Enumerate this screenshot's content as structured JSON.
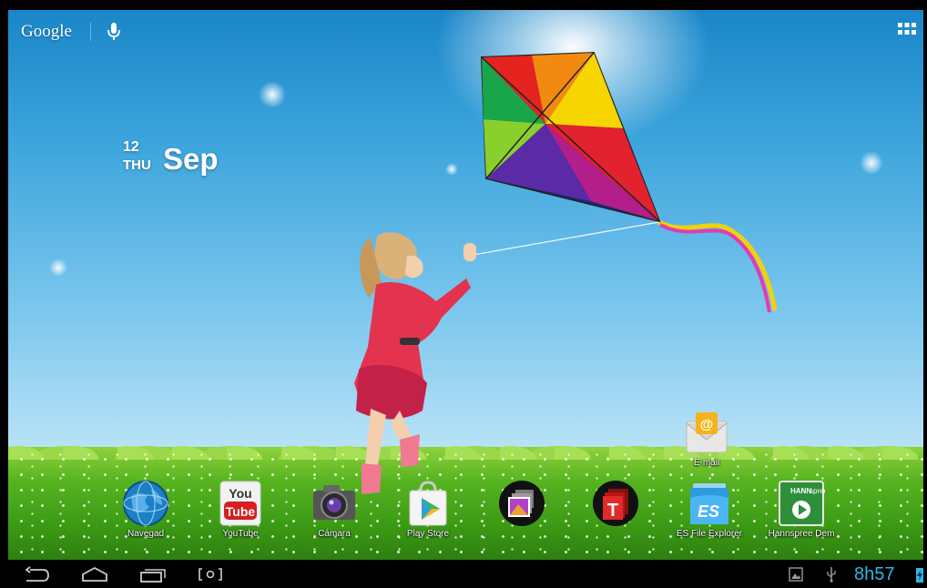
{
  "search": {
    "logo": "Google",
    "mic_icon": "microphone-icon"
  },
  "apps_button_icon": "all-apps-grid-icon",
  "clock": {
    "day": "12",
    "weekday": "THU",
    "month": "Sep"
  },
  "desktop_apps": [
    {
      "label": "E-mail",
      "icon": "email-icon"
    }
  ],
  "dock": [
    {
      "label": "Navegad",
      "icon": "globe-icon"
    },
    {
      "label": "YouTube",
      "icon": "youtube-icon"
    },
    {
      "label": "Cámara",
      "icon": "camera-icon"
    },
    {
      "label": "Play Store",
      "icon": "play-store-icon"
    },
    {
      "label": "",
      "icon": "gallery-icon"
    },
    {
      "label": "",
      "icon": "t-app-icon"
    },
    {
      "label": "ES File Explorer",
      "icon": "es-file-explorer-icon"
    },
    {
      "label": "Hannspree Dem",
      "icon": "hannspree-demo-icon"
    }
  ],
  "youtube_icon_text": {
    "top": "You",
    "bottom": "Tube"
  },
  "hannspree_icon_text": {
    "brand": "HANN",
    "brand2": "spree"
  },
  "es_icon_text": "ES",
  "navbar": {
    "back_icon": "back-icon",
    "home_icon": "home-icon",
    "recents_icon": "recent-apps-icon",
    "screenshot_icon": "screenshot-icon",
    "gallery_notif_icon": "image-notification-icon",
    "usb_icon": "usb-icon",
    "battery_icon": "battery-charging-icon",
    "time": "8h57"
  },
  "colors": {
    "accent_time": "#33b5e5",
    "sky": "#3ea6dd",
    "grass": "#56b421"
  }
}
